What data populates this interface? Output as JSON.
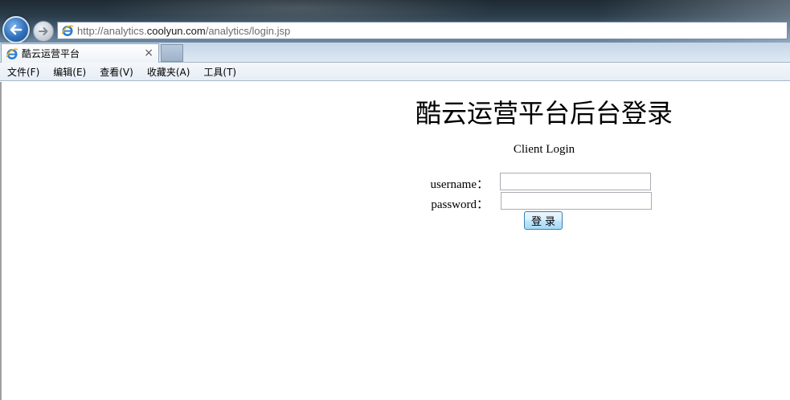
{
  "browser": {
    "address": {
      "prefix": "http://analytics.",
      "domain": "coolyun.com",
      "path": "/analytics/login.jsp"
    },
    "tab": {
      "title": "酷云运营平台",
      "close_label": "×"
    },
    "menu": [
      {
        "label": "文件(F)"
      },
      {
        "label": "编辑(E)"
      },
      {
        "label": "查看(V)"
      },
      {
        "label": "收藏夹(A)"
      },
      {
        "label": "工具(T)"
      }
    ],
    "icons": {
      "back": "back-arrow-icon",
      "forward": "forward-arrow-icon",
      "page": "ie-logo-icon"
    }
  },
  "page": {
    "title": "酷云运营平台后台登录",
    "subtitle": "Client Login",
    "form": {
      "username_label": "username：",
      "username_value": "",
      "password_label": "password：",
      "password_value": "",
      "submit_label": "登录"
    }
  }
}
